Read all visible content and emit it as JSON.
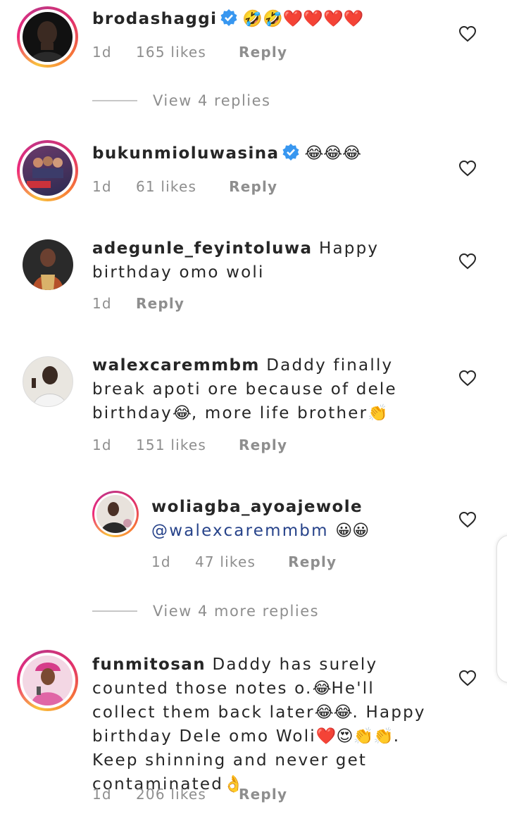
{
  "comments": [
    {
      "username": "brodashaggi",
      "verified": true,
      "text": "",
      "emoji": "🤣🤣❤️❤️❤️❤️",
      "time": "1d",
      "likes": "165 likes",
      "reply_label": "Reply"
    },
    {
      "username": "bukunmioluwasina",
      "verified": true,
      "text": "",
      "emoji": "😂😂😂",
      "time": "1d",
      "likes": "61 likes",
      "reply_label": "Reply"
    },
    {
      "username": "adegunle_feyintoluwa",
      "verified": false,
      "text": "Happy birthday omo woli",
      "time": "1d",
      "likes": "",
      "reply_label": "Reply"
    },
    {
      "username": "walexcaremmbm",
      "verified": false,
      "text_parts": [
        "Daddy finally break apoti ore because of dele birthday",
        "😂",
        ", more life brother",
        "👏"
      ],
      "time": "1d",
      "likes": "151 likes",
      "reply_label": "Reply"
    },
    {
      "username": "woliagba_ayoajewole",
      "verified": false,
      "mention": "@walexcaremmbm",
      "emoji": "😀😀",
      "time": "1d",
      "likes": "47 likes",
      "reply_label": "Reply"
    },
    {
      "username": "funmitosan",
      "verified": false,
      "text_parts": [
        "Daddy has surely counted those notes o.",
        "😂",
        "He'll collect them back later",
        "😂😂",
        ". Happy birthday Dele omo  Woli",
        "❤️😍👏👏",
        ". Keep shinning and never get contaminated",
        "👌"
      ],
      "time": "1d",
      "likes": "206 likes",
      "reply_label": "Reply"
    }
  ],
  "view_replies": [
    {
      "label": "View 4 replies"
    },
    {
      "label": "View 4 more replies"
    }
  ],
  "colors": {
    "verified_blue": "#3897f0",
    "mention": "#27438a",
    "meta_gray": "#8e8e8e"
  },
  "icons": {
    "like": "heart-outline-icon",
    "verified": "verified-badge-icon"
  }
}
